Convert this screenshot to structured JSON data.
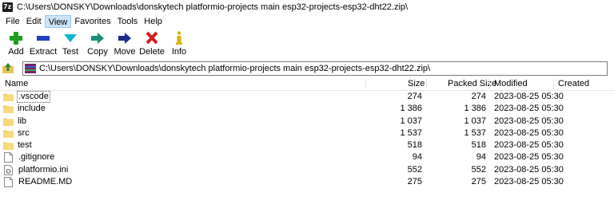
{
  "window": {
    "title": "C:\\Users\\DONSKY\\Downloads\\donskytech platformio-projects main esp32-projects-esp32-dht22.zip\\"
  },
  "menu": [
    {
      "label": "File",
      "active": false
    },
    {
      "label": "Edit",
      "active": false
    },
    {
      "label": "View",
      "active": true
    },
    {
      "label": "Favorites",
      "active": false
    },
    {
      "label": "Tools",
      "active": false
    },
    {
      "label": "Help",
      "active": false
    }
  ],
  "toolbar": [
    {
      "label": "Add",
      "icon": "add-icon",
      "color": "#1ea01e"
    },
    {
      "label": "Extract",
      "icon": "extract-icon",
      "color": "#1f3fbf"
    },
    {
      "label": "Test",
      "icon": "test-icon",
      "color": "#12b5c9"
    },
    {
      "label": "Copy",
      "icon": "copy-icon",
      "color": "#1b8f7a"
    },
    {
      "label": "Move",
      "icon": "move-icon",
      "color": "#1a2b8f"
    },
    {
      "label": "Delete",
      "icon": "delete-icon",
      "color": "#d21f1f"
    },
    {
      "label": "Info",
      "icon": "info-icon",
      "color": "#d8b400"
    }
  ],
  "address": {
    "path": "C:\\Users\\DONSKY\\Downloads\\donskytech platformio-projects main esp32-projects-esp32-dht22.zip\\"
  },
  "columns": {
    "name": "Name",
    "size": "Size",
    "packed": "Packed Size",
    "modified": "Modified",
    "created": "Created"
  },
  "rows": [
    {
      "name": ".vscode",
      "type": "folder",
      "size": "274",
      "packed": "274",
      "modified": "2023-08-25 05:30",
      "focused": true
    },
    {
      "name": "include",
      "type": "folder",
      "size": "1 386",
      "packed": "1 386",
      "modified": "2023-08-25 05:30"
    },
    {
      "name": "lib",
      "type": "folder",
      "size": "1 037",
      "packed": "1 037",
      "modified": "2023-08-25 05:30"
    },
    {
      "name": "src",
      "type": "folder",
      "size": "1 537",
      "packed": "1 537",
      "modified": "2023-08-25 05:30"
    },
    {
      "name": "test",
      "type": "folder",
      "size": "518",
      "packed": "518",
      "modified": "2023-08-25 05:30"
    },
    {
      "name": ".gitignore",
      "type": "file",
      "size": "94",
      "packed": "94",
      "modified": "2023-08-25 05:30"
    },
    {
      "name": "platformio.ini",
      "type": "ini",
      "size": "552",
      "packed": "552",
      "modified": "2023-08-25 05:30"
    },
    {
      "name": "README.MD",
      "type": "file",
      "size": "275",
      "packed": "275",
      "modified": "2023-08-25 05:30"
    }
  ]
}
